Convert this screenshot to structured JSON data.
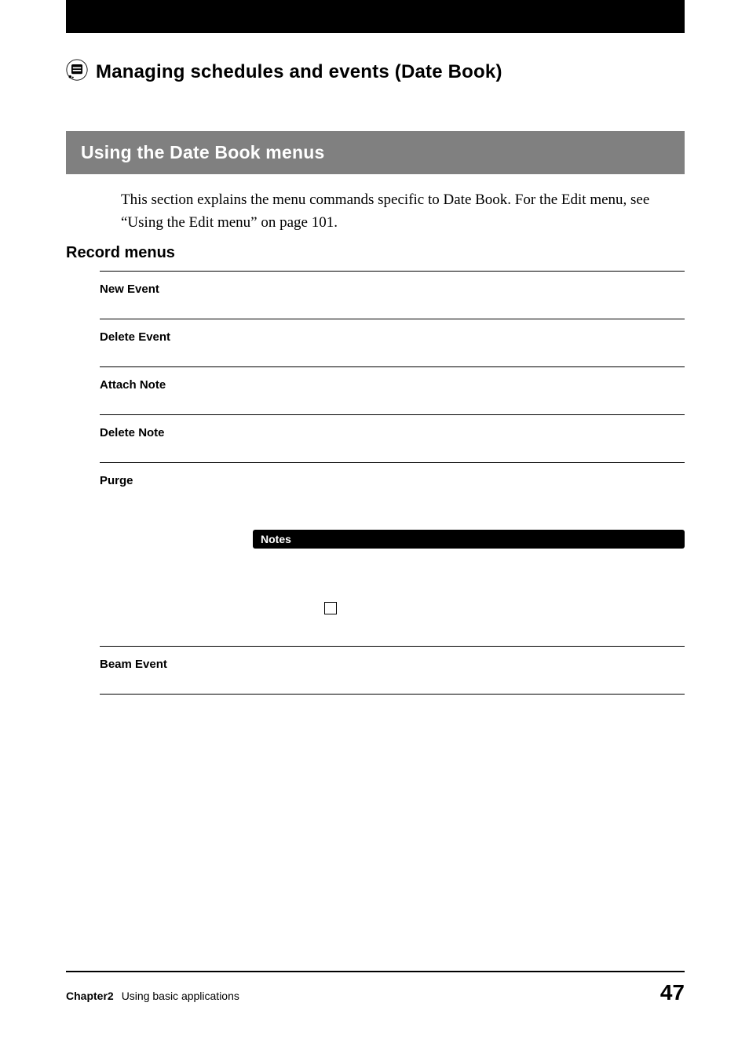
{
  "heading": "Managing schedules and events (Date Book)",
  "banner": "Using the Date Book menus",
  "intro": "This section explains the menu commands specific to Date Book. For the Edit menu, see “Using the Edit menu” on page 101.",
  "subheading": "Record menus",
  "menu_items": {
    "new_event": "New Event",
    "delete_event": "Delete Event",
    "attach_note": "Attach Note",
    "delete_note": "Delete Note",
    "purge": "Purge",
    "beam_event": "Beam Event"
  },
  "notes_label": "Notes",
  "footer": {
    "chapter": "Chapter2",
    "chapter_text": "Using basic applications",
    "page_number": "47"
  }
}
